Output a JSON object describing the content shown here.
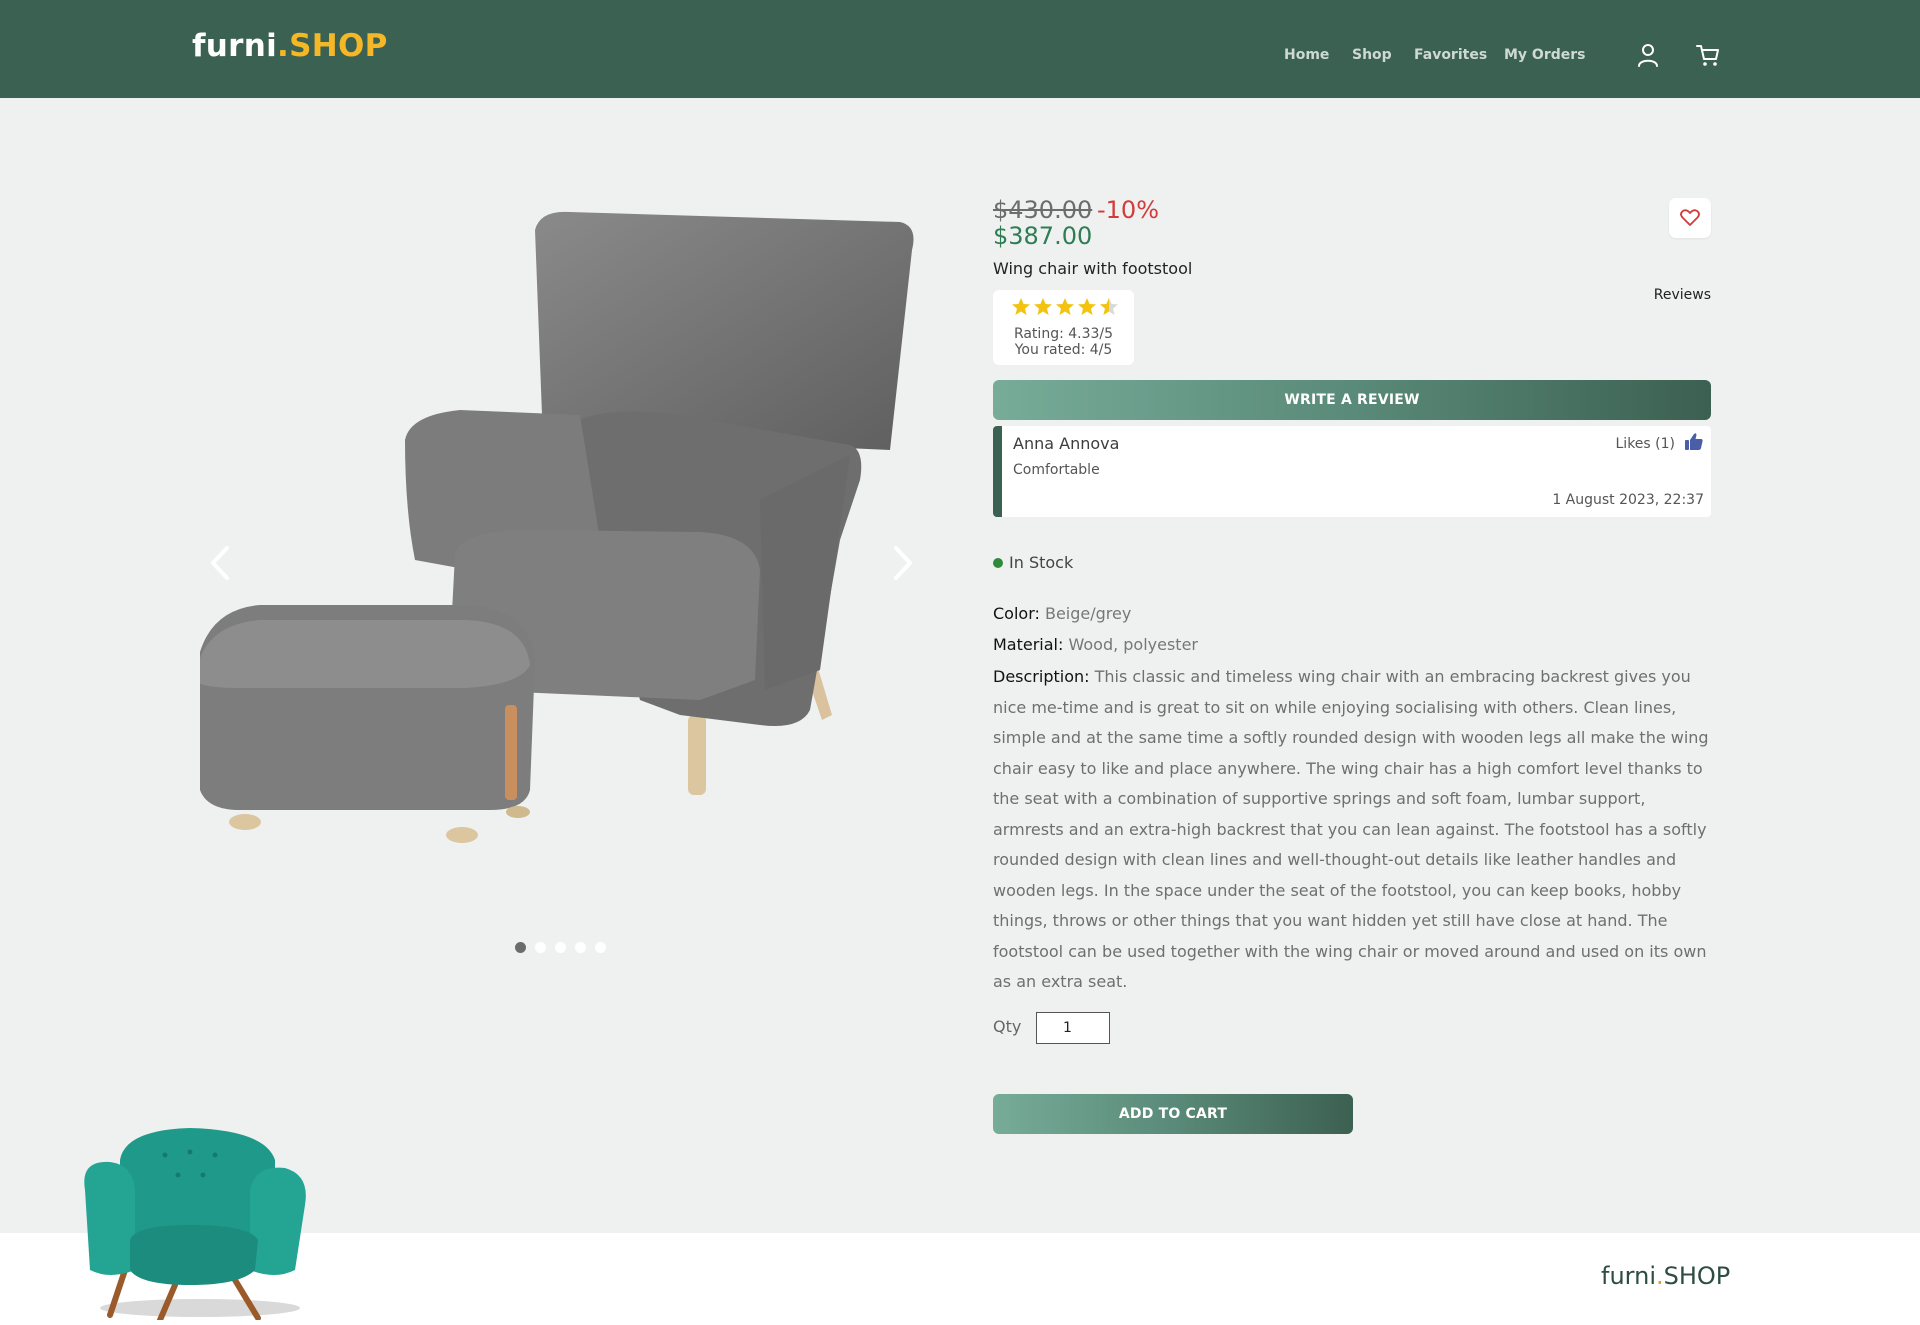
{
  "brand": {
    "name_part1": "furni",
    "name_dot": ".",
    "name_part2": "SHOP"
  },
  "header": {
    "nav": [
      {
        "label": "Home"
      },
      {
        "label": "Shop"
      },
      {
        "label": "Favorites"
      },
      {
        "label": "My Orders"
      }
    ],
    "icons": [
      "user-icon",
      "cart-icon"
    ]
  },
  "carousel": {
    "image": "grey-wing-chair-with-footstool",
    "slide_count": 5,
    "active_slide": 1
  },
  "product": {
    "old_price": "$430.00",
    "discount": "-10%",
    "price": "$387.00",
    "name": "Wing chair with footstool",
    "rating_stars": 4.33,
    "rating_text": "Rating: 4.33/5",
    "user_rating_text": "You rated: 4/5",
    "reviews_label": "Reviews",
    "write_review_label": "WRITE A REVIEW",
    "stock_status": "In Stock",
    "color_label": "Color:",
    "color_value": " Beige/grey",
    "material_label": "Material:",
    "material_value": " Wood, polyester",
    "description_label": "Description:",
    "description": " This classic and timeless wing chair with an embracing backrest gives you nice me-time and is great to sit on while enjoying socialising with others. Clean lines, simple and at the same time a softly rounded design with wooden legs all make the wing chair easy to like and place anywhere. The wing chair has a high comfort level thanks to the seat with a combination of supportive springs and soft foam, lumbar support, armrests and an extra-high backrest that you can lean against. The footstool has a softly rounded design with clean lines and well-thought-out details like leather handles and wooden legs. In the space under the seat of the footstool, you can keep books, hobby things, throws or other things that you want hidden yet still have close at hand. The footstool can be used together with the wing chair or moved around and used on its own as an extra seat.",
    "qty_label": "Qty",
    "qty_value": "1",
    "add_to_cart_label": "ADD TO CART"
  },
  "review": {
    "author": "Anna Annova",
    "text": "Comfortable",
    "likes": "Likes (1)",
    "date": "1 August 2023, 22:37"
  },
  "footer": {
    "logo_part1": "furni",
    "logo_dot": ".",
    "logo_part2": "SHOP"
  },
  "colors": {
    "header_bg": "#3b6152",
    "accent_yellow": "#f4b728",
    "price_green": "#2e7d55",
    "discount_red": "#d33a3a",
    "background": "#eff1f0"
  }
}
